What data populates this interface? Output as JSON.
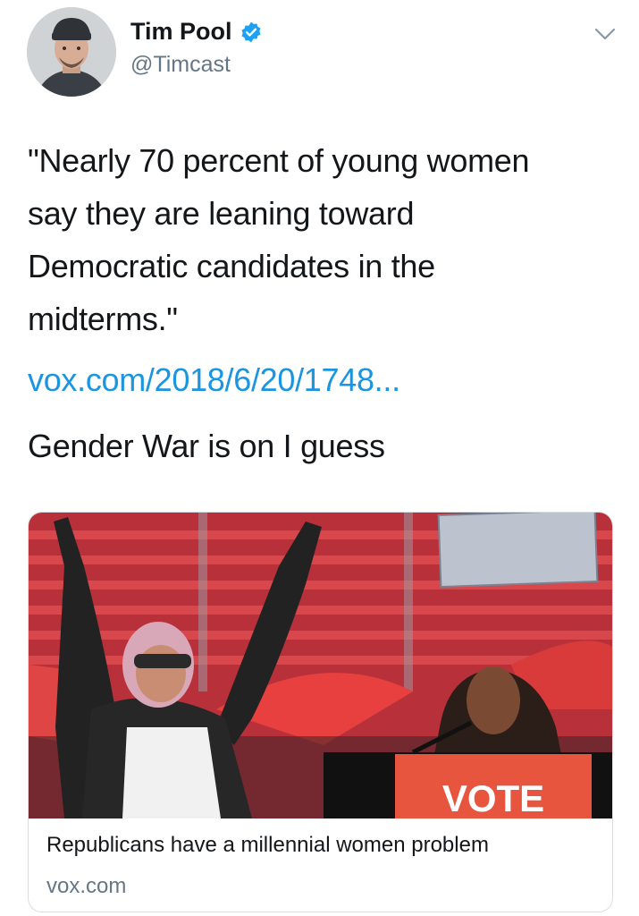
{
  "author": {
    "display_name": "Tim Pool",
    "handle": "@Timcast",
    "verified_icon": "verified-badge-icon",
    "avatar_icon": "avatar-photo"
  },
  "menu_icon": "chevron-down-icon",
  "tweet": {
    "quote_lines": [
      "\"Nearly 70 percent of young women",
      "say they are leaning toward",
      "Democratic candidates in the",
      "midterms.\""
    ],
    "link_text": "vox.com/2018/6/20/1748...",
    "comment": "Gender War is on I guess"
  },
  "card": {
    "image_sign_text": "VOTE",
    "title": "Republicans have a millennial women problem",
    "domain": "vox.com"
  },
  "colors": {
    "link": "#1b95e0",
    "verified": "#1da1f2",
    "secondary_text": "#657786",
    "stadium_red": "#c2363a",
    "vote_sign": "#e8553f"
  }
}
